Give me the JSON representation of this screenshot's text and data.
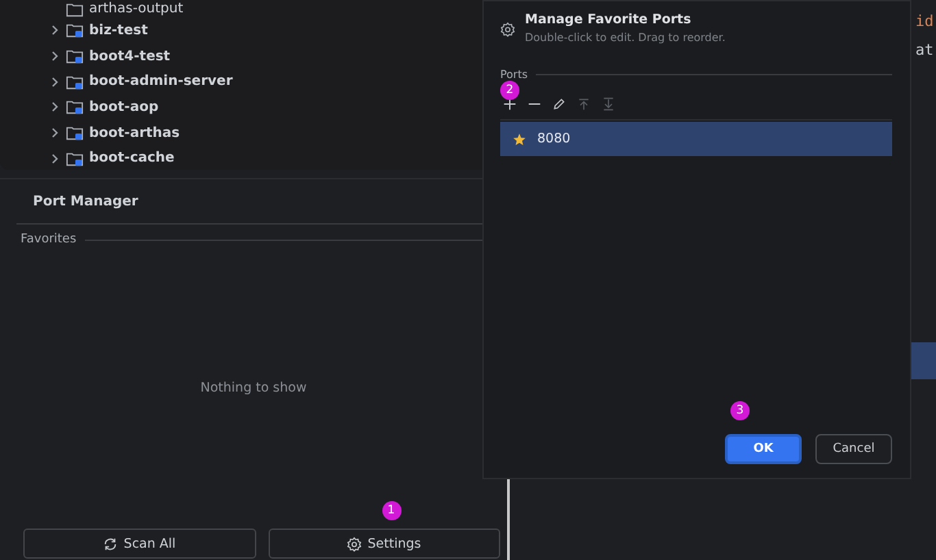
{
  "tree": {
    "items": [
      {
        "label": "arthas-output",
        "kind": "folder",
        "bold": false,
        "expandable": false
      },
      {
        "label": "biz-test",
        "kind": "module",
        "bold": true,
        "expandable": true
      },
      {
        "label": "boot4-test",
        "kind": "module",
        "bold": true,
        "expandable": true
      },
      {
        "label": "boot-admin-server",
        "kind": "module",
        "bold": true,
        "expandable": true
      },
      {
        "label": "boot-aop",
        "kind": "module",
        "bold": true,
        "expandable": true
      },
      {
        "label": "boot-arthas",
        "kind": "module",
        "bold": true,
        "expandable": true
      },
      {
        "label": "boot-cache",
        "kind": "module",
        "bold": true,
        "expandable": true
      }
    ]
  },
  "port_manager": {
    "title": "Port Manager",
    "section": "Favorites",
    "empty_text": "Nothing to show",
    "buttons": [
      {
        "label": "Scan All",
        "kind": "refresh"
      },
      {
        "label": "Settings",
        "kind": "gear"
      }
    ]
  },
  "editor": {
    "lines": [
      "id",
      "at"
    ]
  },
  "dialog": {
    "title": "Manage Favorite Ports",
    "subtitle": "Double-click to edit. Drag to reorder.",
    "section": "Ports",
    "toolbar": [
      {
        "kind": "add",
        "disabled": false
      },
      {
        "kind": "remove",
        "disabled": false
      },
      {
        "kind": "edit",
        "disabled": false
      },
      {
        "kind": "up",
        "disabled": true
      },
      {
        "kind": "down",
        "disabled": true
      }
    ],
    "ports": [
      {
        "label": "8080",
        "selected": true,
        "favorite": true
      }
    ],
    "buttons": [
      {
        "label": "OK",
        "primary": true
      },
      {
        "label": "Cancel",
        "primary": false
      }
    ]
  },
  "markers": [
    {
      "label": "1"
    },
    {
      "label": "2"
    },
    {
      "label": "3"
    }
  ]
}
